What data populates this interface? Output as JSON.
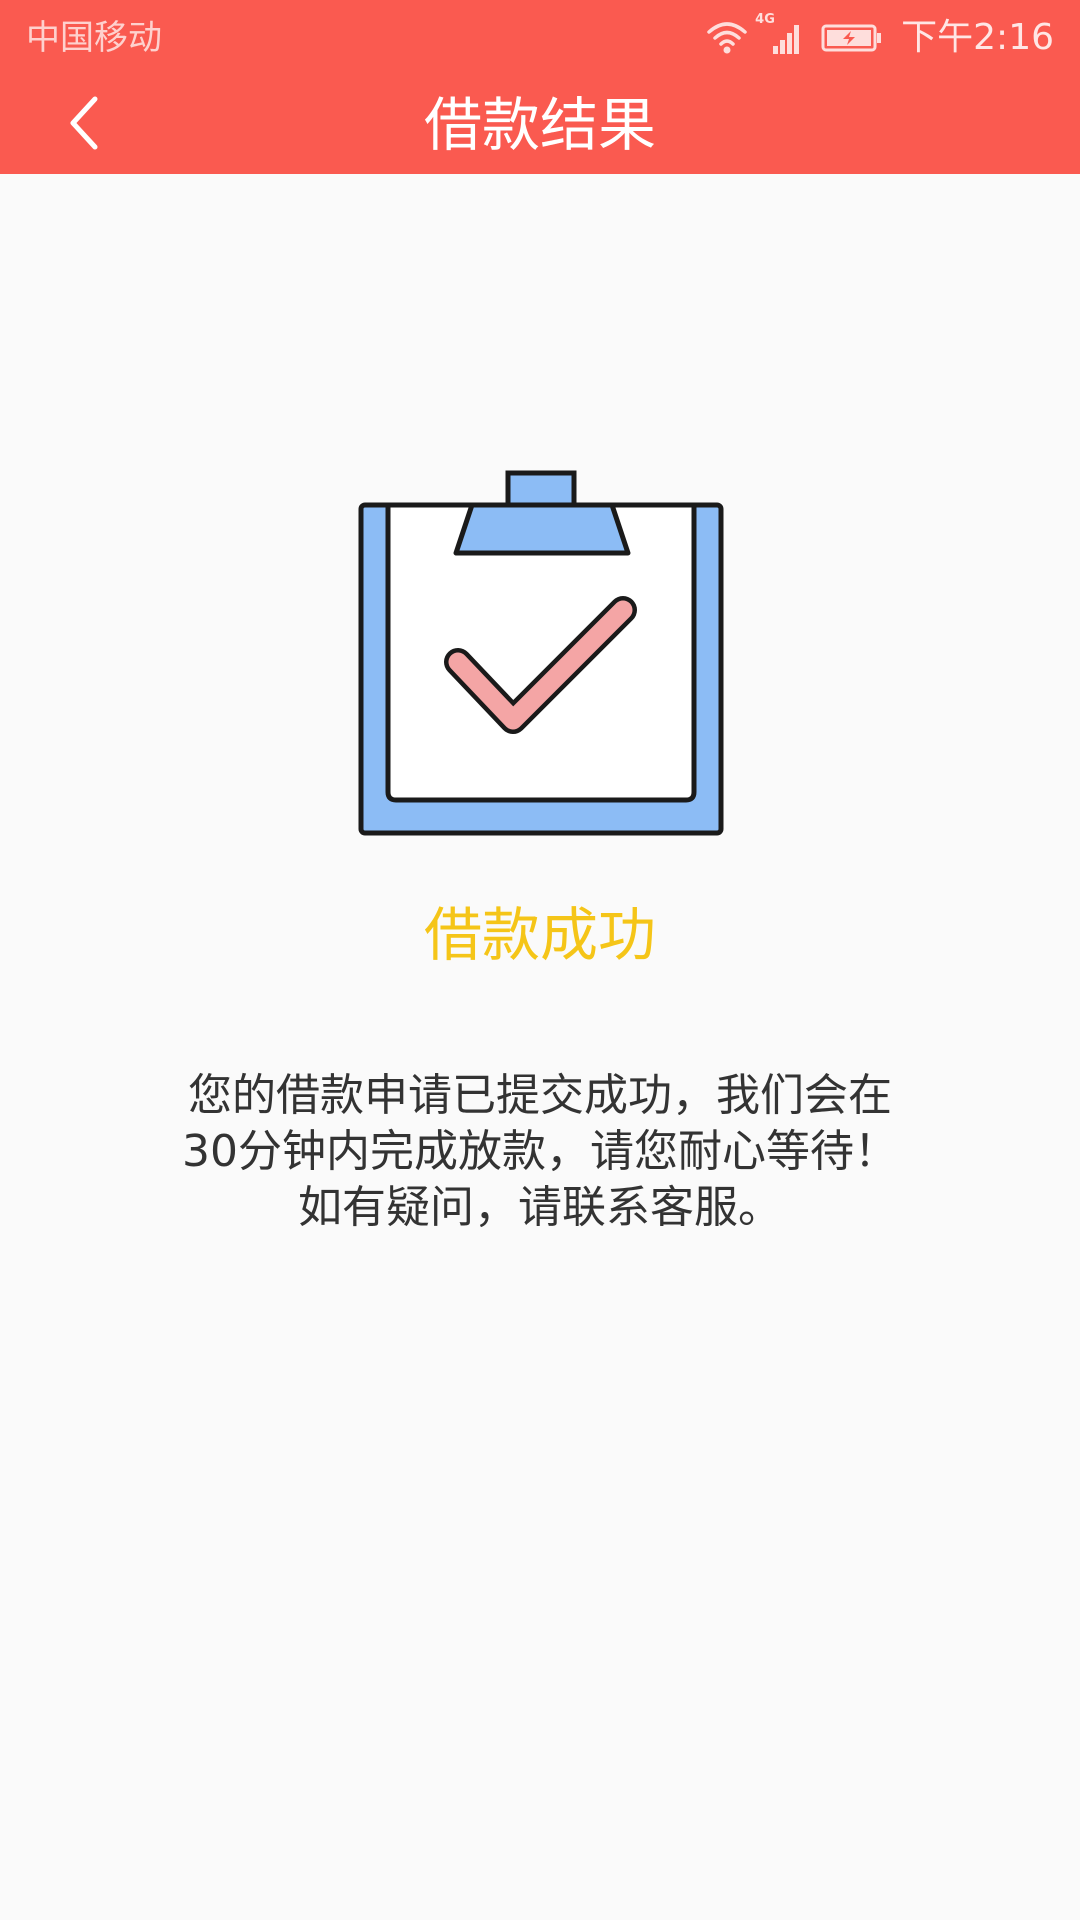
{
  "status_bar": {
    "carrier": "中国移动",
    "network_label": "4G",
    "time": "下午2:16",
    "icons": [
      "wifi-icon",
      "signal-icon",
      "battery-icon"
    ]
  },
  "nav": {
    "back_icon": "chevron-left-icon",
    "title": "借款结果"
  },
  "result": {
    "illustration": "clipboard-check-icon",
    "title": "借款成功",
    "message_lines": [
      "您的借款申请已提交成功，我们会在",
      "30分钟内完成放款，请您耐心等待！",
      "如有疑问，请联系客服。"
    ]
  },
  "colors": {
    "header": "#fa5a50",
    "success_title": "#f5c518",
    "body_text": "#333333",
    "background": "#fafafa",
    "clipboard_blue": "#8cbcf5",
    "check_pink": "#f4a5a5"
  }
}
